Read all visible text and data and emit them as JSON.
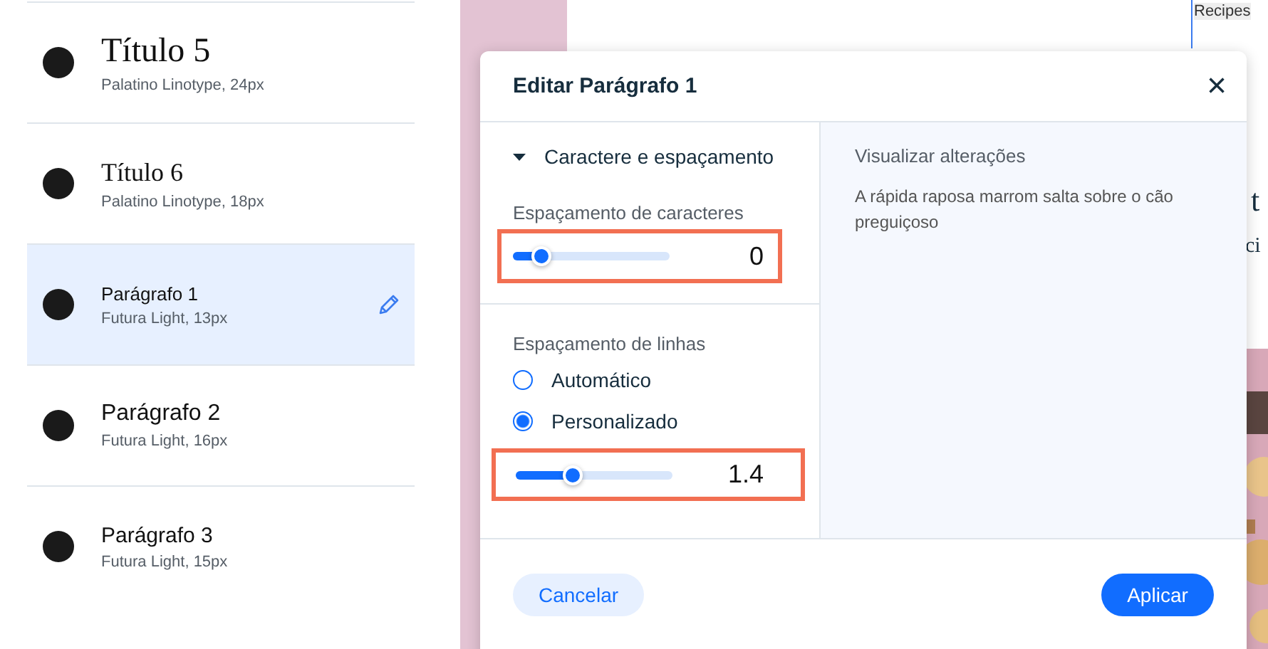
{
  "styles_list": [
    {
      "name": "Título 5",
      "font": "Palatino Linotype, 24px",
      "kind": "heading-large",
      "selected": false
    },
    {
      "name": "Título 6",
      "font": "Palatino Linotype, 18px",
      "kind": "heading-small",
      "selected": false
    },
    {
      "name": "Parágrafo 1",
      "font": "Futura Light, 13px",
      "kind": "paragraph-small",
      "selected": true
    },
    {
      "name": "Parágrafo 2",
      "font": "Futura Light, 16px",
      "kind": "paragraph-large",
      "selected": false
    },
    {
      "name": "Parágrafo 3",
      "font": "Futura Light, 15px",
      "kind": "paragraph-medium",
      "selected": false
    }
  ],
  "background_page": {
    "tab_label": "Recipes",
    "fragment_1": "t",
    "fragment_2": "ci"
  },
  "dialog": {
    "title": "Editar Parágrafo 1",
    "close": "×",
    "section": {
      "title": "Caractere e espaçamento",
      "expanded": true
    },
    "char_spacing": {
      "label": "Espaçamento de caracteres",
      "level": 0.18,
      "value": "0",
      "highlighted": true
    },
    "line_spacing": {
      "label": "Espaçamento de linhas",
      "options": [
        {
          "label": "Automático",
          "selected": false
        },
        {
          "label": "Personalizado",
          "selected": true
        }
      ],
      "level": 0.36,
      "value": "1.4",
      "highlighted": true
    },
    "preview": {
      "title": "Visualizar alterações",
      "text": "A rápida raposa marrom salta sobre o cão preguiçoso"
    },
    "buttons": {
      "cancel": "Cancelar",
      "apply": "Aplicar"
    }
  }
}
